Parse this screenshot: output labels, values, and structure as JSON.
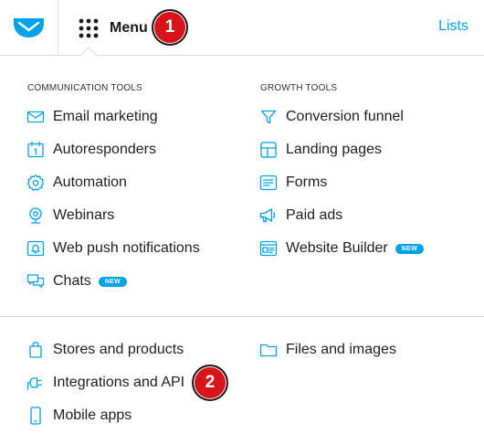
{
  "header": {
    "menu_label": "Menu",
    "lists_label": "Lists"
  },
  "callouts": [
    "1",
    "2"
  ],
  "sections": {
    "communication": {
      "heading": "COMMUNICATION TOOLS",
      "items": [
        {
          "label": "Email marketing",
          "icon": "envelope-icon"
        },
        {
          "label": "Autoresponders",
          "icon": "calendar-icon"
        },
        {
          "label": "Automation",
          "icon": "gear-icon"
        },
        {
          "label": "Webinars",
          "icon": "webcam-icon"
        },
        {
          "label": "Web push notifications",
          "icon": "bell-icon"
        },
        {
          "label": "Chats",
          "icon": "chat-icon",
          "badge": "NEW"
        }
      ]
    },
    "growth": {
      "heading": "GROWTH TOOLS",
      "items": [
        {
          "label": "Conversion funnel",
          "icon": "funnel-icon"
        },
        {
          "label": "Landing pages",
          "icon": "layout-icon"
        },
        {
          "label": "Forms",
          "icon": "form-icon"
        },
        {
          "label": "Paid ads",
          "icon": "megaphone-icon"
        },
        {
          "label": "Website Builder",
          "icon": "website-icon",
          "badge": "NEW"
        }
      ]
    },
    "other_left": [
      {
        "label": "Stores and products",
        "icon": "shopping-bag-icon"
      },
      {
        "label": "Integrations and API",
        "icon": "plug-icon"
      },
      {
        "label": "Mobile apps",
        "icon": "phone-icon"
      }
    ],
    "other_right": [
      {
        "label": "Files and images",
        "icon": "folder-icon"
      }
    ]
  },
  "colors": {
    "accent": "#00a2ea",
    "callout": "#d7141a"
  }
}
